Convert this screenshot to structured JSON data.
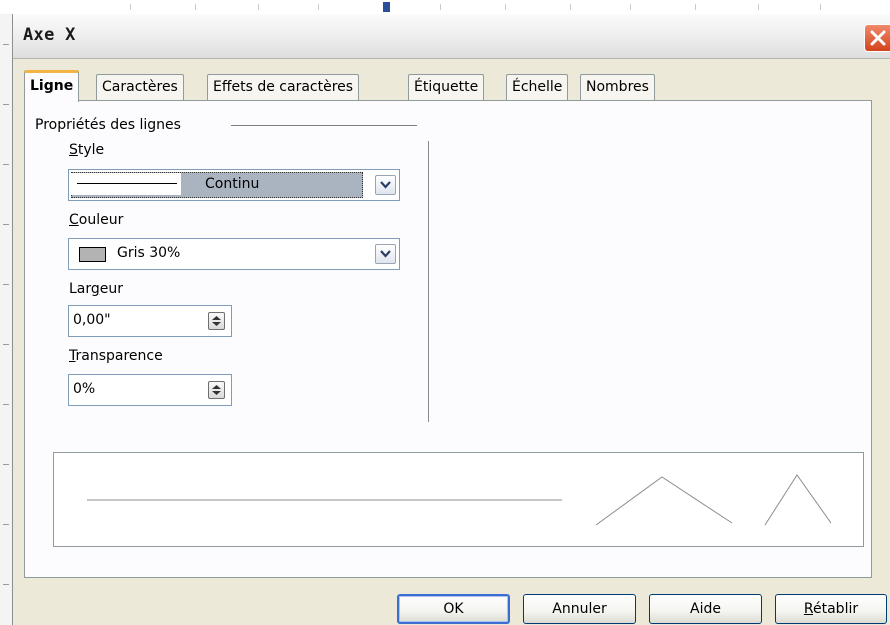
{
  "dialog": {
    "title": "Axe X"
  },
  "tabs": [
    {
      "label": "Ligne",
      "active": true
    },
    {
      "label": "Caractères",
      "active": false
    },
    {
      "label": "Effets de caractères",
      "active": false
    },
    {
      "label": "Étiquette",
      "active": false
    },
    {
      "label": "Échelle",
      "active": false
    },
    {
      "label": "Nombres",
      "active": false
    }
  ],
  "line_properties": {
    "group_label": "Propriétés des lignes",
    "style": {
      "label_ul": "S",
      "label_rest": "tyle",
      "value": "Continu"
    },
    "color": {
      "label_ul": "C",
      "label_rest": "ouleur",
      "value": "Gris 30%",
      "swatch_color": "#b3b3b3"
    },
    "width": {
      "label_pre": "Lar",
      "label_ul": "g",
      "label_rest": "eur",
      "value": "0,00\""
    },
    "transparency": {
      "label_ul": "T",
      "label_rest": "ransparence",
      "value": "0%"
    }
  },
  "buttons": {
    "ok": "OK",
    "cancel": "Annuler",
    "help": "Aide",
    "reset_ul": "R",
    "reset_rest": "établir"
  },
  "colors": {
    "dialog_bg": "#ece9d8",
    "active_tab_accent": "#f2b544",
    "close_button": "#d4431c",
    "default_button_border": "#3c6dd0"
  }
}
